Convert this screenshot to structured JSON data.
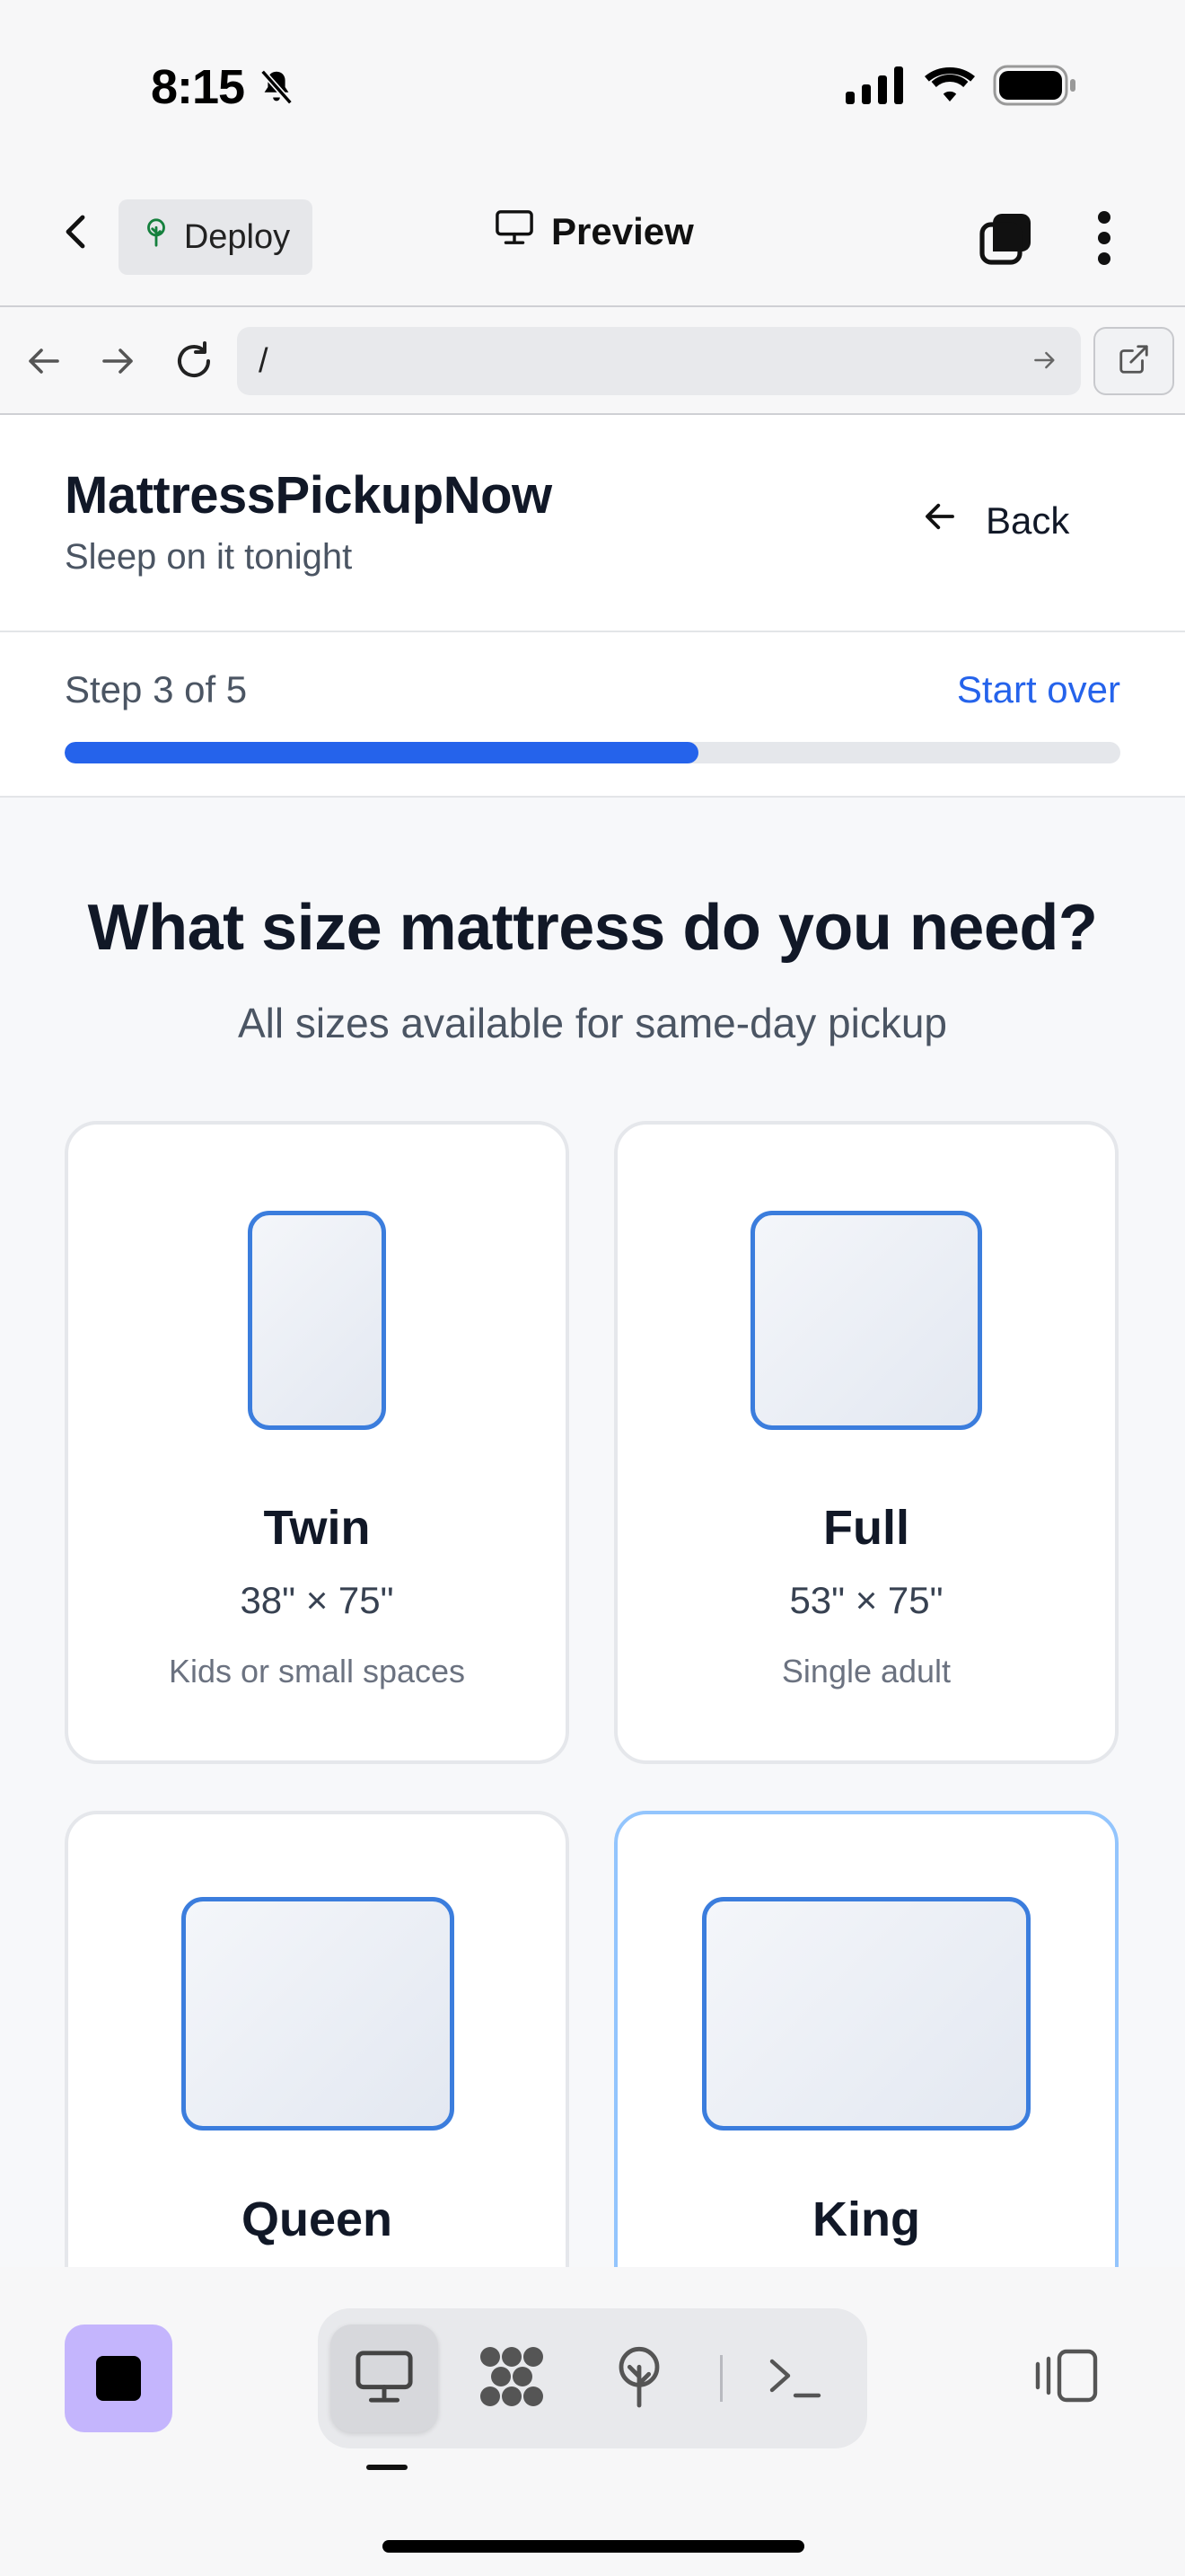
{
  "status_bar": {
    "time": "8:15"
  },
  "app_bar": {
    "deploy_label": "Deploy",
    "preview_label": "Preview"
  },
  "browser": {
    "url": "/"
  },
  "site": {
    "brand": "MattressPickupNow",
    "tagline": "Sleep on it tonight",
    "back_label": "Back"
  },
  "progress": {
    "step_label": "Step 3 of 5",
    "start_over_label": "Start over",
    "current_step": 3,
    "total_steps": 5,
    "fill_fraction": 0.6
  },
  "question": {
    "title": "What size mattress do you need?",
    "subtitle": "All sizes available for same-day pickup"
  },
  "sizes": [
    {
      "name": "Twin",
      "dims": "38\" × 75\"",
      "desc": "Kids or small spaces"
    },
    {
      "name": "Full",
      "dims": "53\" × 75\"",
      "desc": "Single adult"
    },
    {
      "name": "Queen",
      "dims": "",
      "desc": ""
    },
    {
      "name": "King",
      "dims": "",
      "desc": ""
    }
  ],
  "colors": {
    "accent": "#2563eb",
    "bed_stroke": "#3b7ddd",
    "selected_border": "#93c5fd",
    "app_icon_bg": "#c4b5fd"
  }
}
